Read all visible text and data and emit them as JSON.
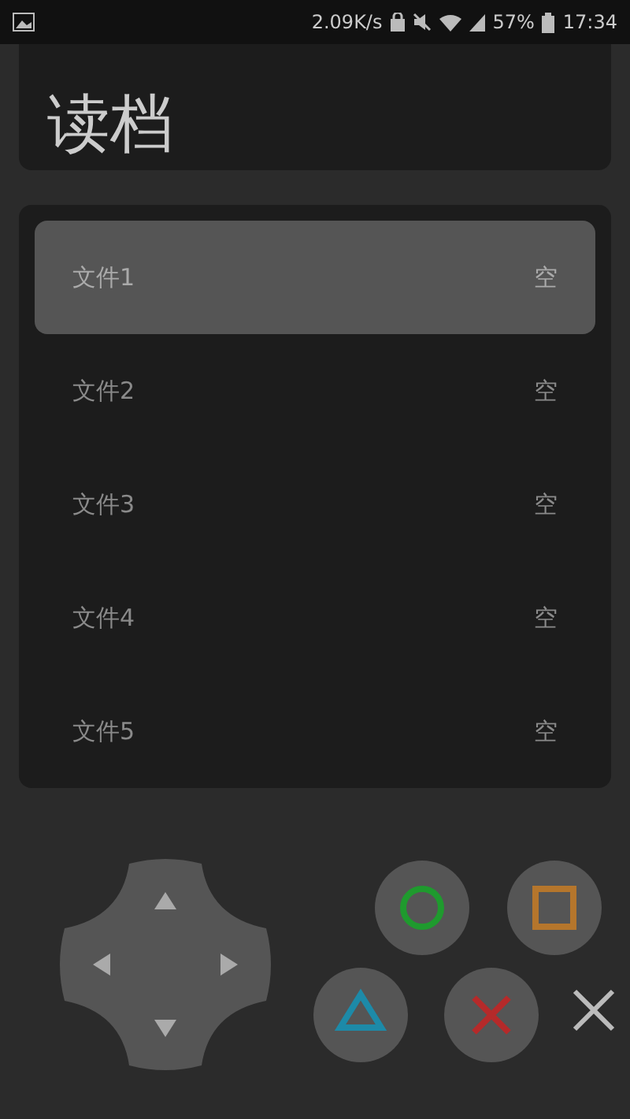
{
  "status_bar": {
    "speed": "2.09K/s",
    "battery": "57%",
    "time": "17:34"
  },
  "title": "读档",
  "slots": [
    {
      "name": "文件1",
      "status": "空",
      "selected": true
    },
    {
      "name": "文件2",
      "status": "空",
      "selected": false
    },
    {
      "name": "文件3",
      "status": "空",
      "selected": false
    },
    {
      "name": "文件4",
      "status": "空",
      "selected": false
    },
    {
      "name": "文件5",
      "status": "空",
      "selected": false
    }
  ]
}
